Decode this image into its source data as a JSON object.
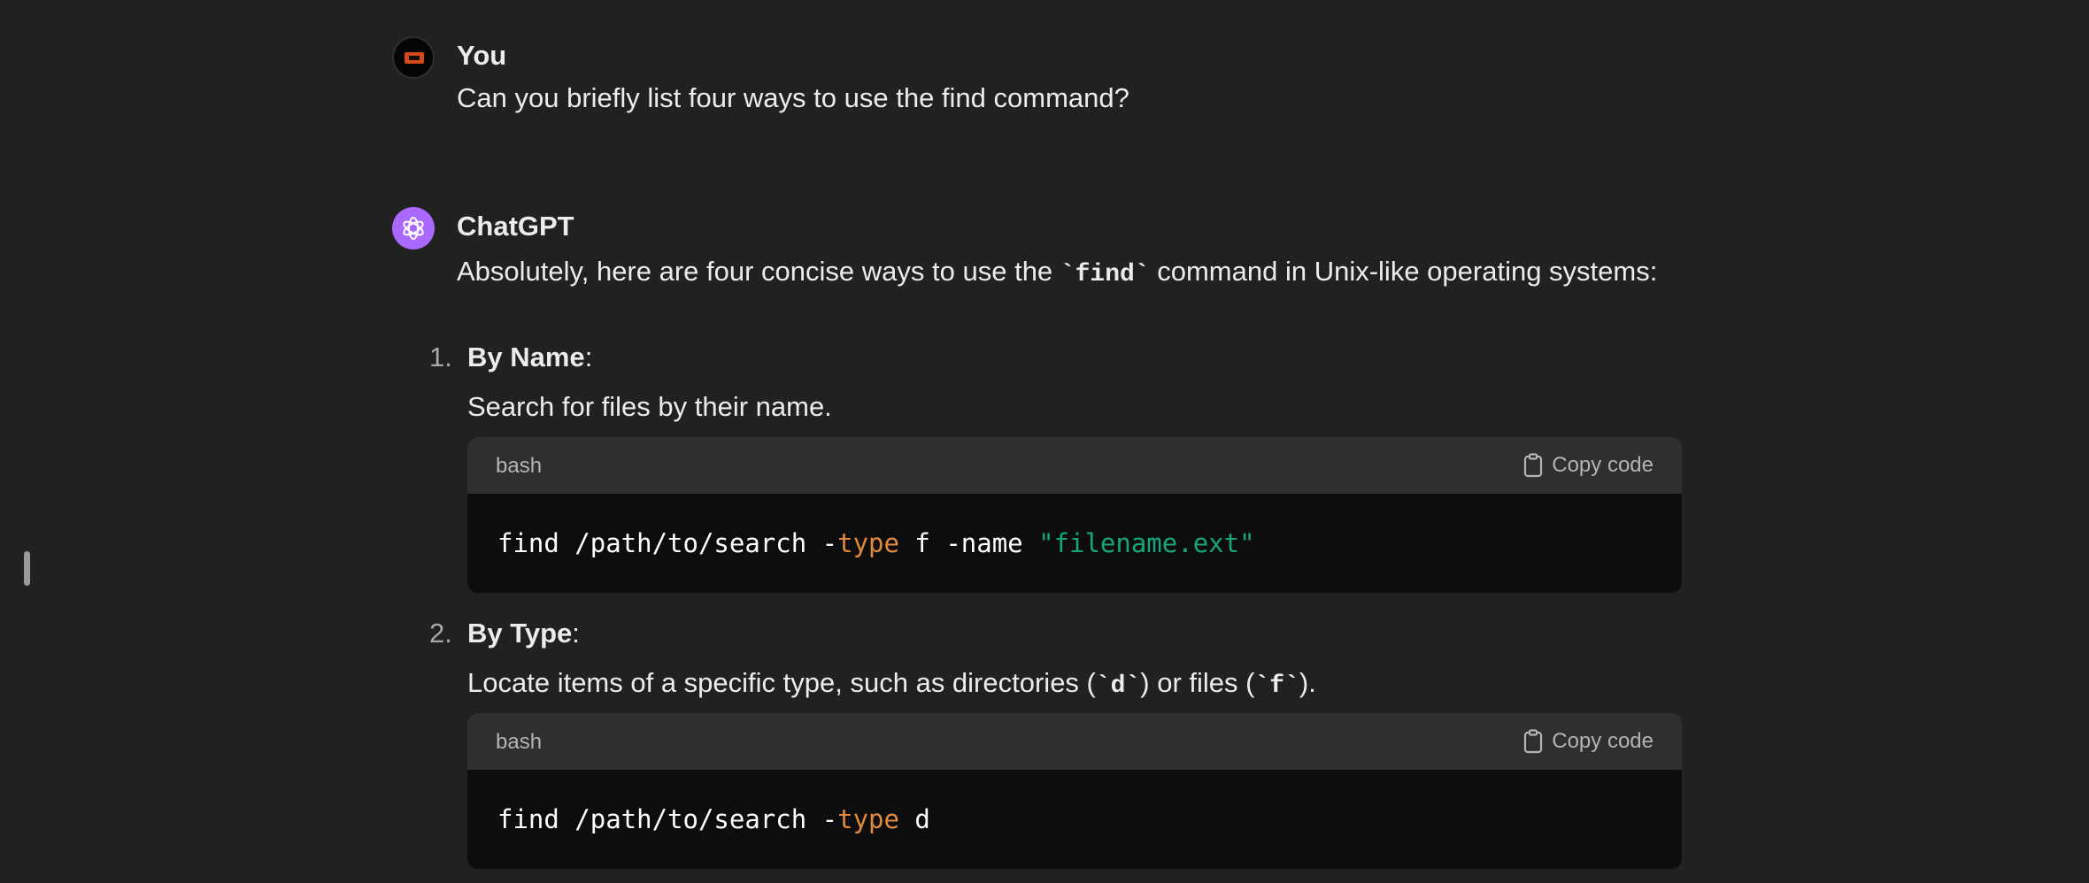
{
  "conversation": {
    "user": {
      "name": "You",
      "message": "Can you briefly list four ways to use the find command?"
    },
    "assistant": {
      "name": "ChatGPT",
      "intro_before": "Absolutely, here are four concise ways to use the ",
      "intro_code": "`find`",
      "intro_after": " command in Unix-like operating systems:",
      "items": [
        {
          "number": "1.",
          "title": "By Name",
          "title_suffix": ":",
          "description": "Search for files by their name.",
          "code": {
            "language": "bash",
            "copy_label": "Copy code",
            "parts": {
              "p1": "find /path/to/search -",
              "kw": "type",
              "p2": " f -name ",
              "str": "\"filename.ext\""
            }
          }
        },
        {
          "number": "2.",
          "title": "By Type",
          "title_suffix": ":",
          "description_before": "Locate items of a specific type, such as directories (",
          "description_code1": "`d`",
          "description_mid": ") or files (",
          "description_code2": "`f`",
          "description_after": ").",
          "code": {
            "language": "bash",
            "copy_label": "Copy code",
            "parts": {
              "p1": "find /path/to/search -",
              "kw": "type",
              "p2": " d"
            }
          }
        }
      ]
    }
  },
  "colors": {
    "background": "#212121",
    "code_header": "#2f2f2f",
    "code_body": "#0d0d0d",
    "assistant_avatar": "#ab68ff",
    "keyword": "#df8a3c",
    "string": "#17a57a"
  },
  "icons": {
    "user_avatar": "user-avatar",
    "assistant_avatar": "openai-logo-icon",
    "copy": "clipboard-icon"
  }
}
